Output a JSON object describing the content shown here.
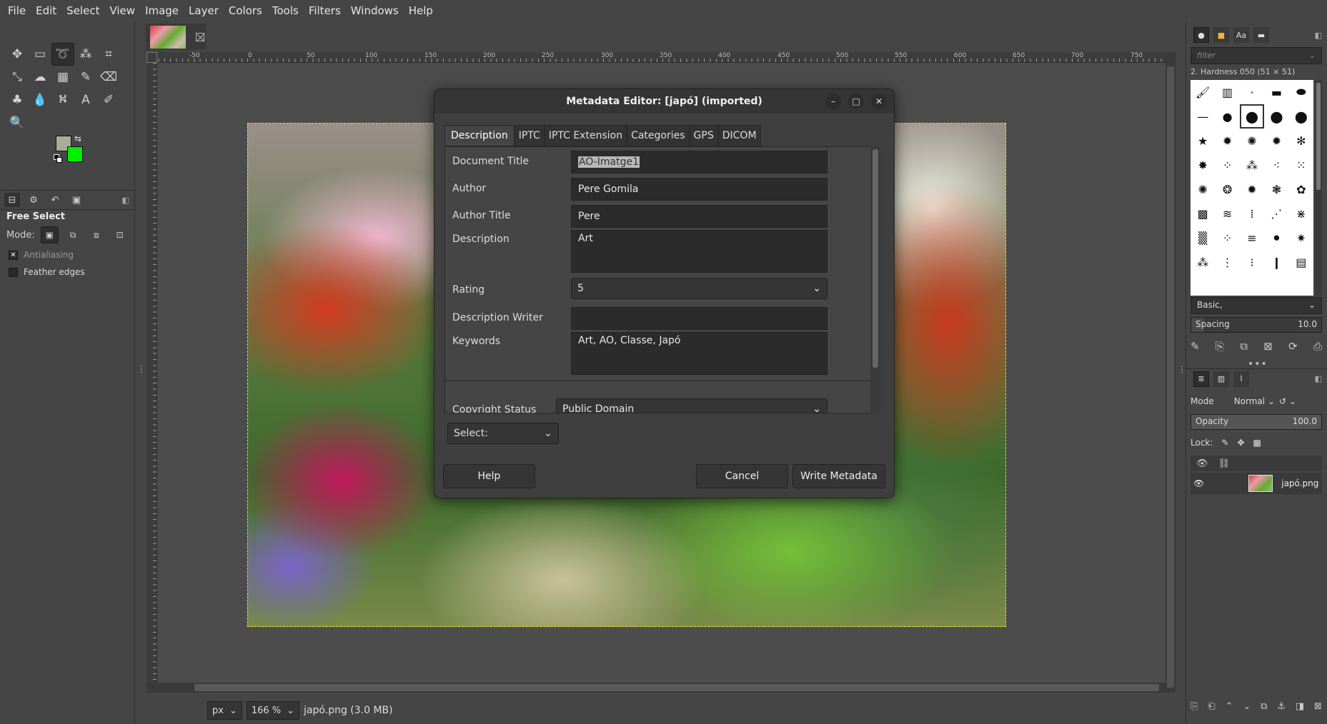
{
  "menubar": [
    "File",
    "Edit",
    "Select",
    "View",
    "Image",
    "Layer",
    "Colors",
    "Tools",
    "Filters",
    "Windows",
    "Help"
  ],
  "colors": {
    "foreground": "#a8ad98",
    "background": "#00f000",
    "selection": "#e4e400"
  },
  "tool_options": {
    "title": "Free Select",
    "mode_label": "Mode:",
    "antialiasing": "Antialiasing",
    "feather_edges": "Feather edges"
  },
  "ruler": {
    "marks": [
      "-50",
      "0",
      "50",
      "100",
      "150",
      "200",
      "250",
      "300",
      "350",
      "400",
      "450",
      "500",
      "550",
      "600",
      "650",
      "700",
      "750"
    ]
  },
  "statusbar": {
    "unit": "px",
    "zoom": "166 %",
    "file_info": "japó.png (3.0 MB)"
  },
  "brushes": {
    "filter_placeholder": "filter",
    "selected_brush": "2. Hardness 050 (51 × 51)",
    "preset": "Basic,",
    "spacing_label": "Spacing",
    "spacing_value": "10.0"
  },
  "layers": {
    "mode_label": "Mode",
    "mode_value": "Normal",
    "opacity_label": "Opacity",
    "opacity_value": "100.0",
    "lock_label": "Lock:",
    "layer_name": "japó.png"
  },
  "dialog": {
    "title": "Metadata Editor: [japó] (imported)",
    "tabs": [
      "Description",
      "IPTC",
      "IPTC Extension",
      "Categories",
      "GPS",
      "DICOM"
    ],
    "fields": {
      "document_title_label": "Document Title",
      "document_title_value": "AO-Imatge1",
      "author_label": "Author",
      "author_value": "Pere Gomila",
      "author_title_label": "Author Title",
      "author_title_value": "Pere",
      "description_label": "Description",
      "description_value": "Art",
      "rating_label": "Rating",
      "rating_value": "5",
      "description_writer_label": "Description Writer",
      "description_writer_value": "",
      "keywords_label": "Keywords",
      "keywords_value": "Art, AO, Classe, Japó",
      "copyright_status_label": "Copyright Status",
      "copyright_status_value": "Public Domain"
    },
    "select_label": "Select:",
    "buttons": {
      "help": "Help",
      "cancel": "Cancel",
      "write": "Write Metadata"
    }
  }
}
